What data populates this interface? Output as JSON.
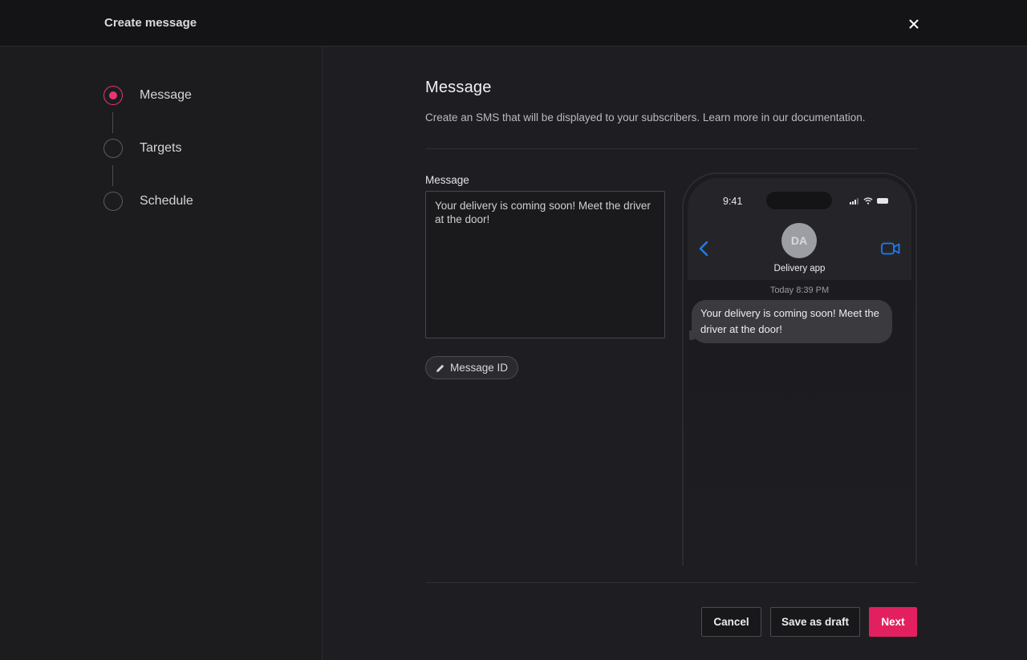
{
  "header": {
    "title": "Create message",
    "close_icon": "close-icon"
  },
  "steps": [
    {
      "label": "Message",
      "state": "active"
    },
    {
      "label": "Targets",
      "state": "pending"
    },
    {
      "label": "Schedule",
      "state": "pending"
    }
  ],
  "main": {
    "heading": "Message",
    "description": "Create an SMS that will be displayed to your subscribers. Learn more in our documentation.",
    "field_label": "Message",
    "message_value": "Your delivery is coming soon! Meet the driver at the door!",
    "chip_label": "Message ID"
  },
  "phone": {
    "time": "9:41",
    "avatar_initials": "DA",
    "contact_name": "Delivery app",
    "timestamp": "Today 8:39 PM",
    "bubble_text": "Your delivery is coming soon! Meet the driver at the door!"
  },
  "footer": {
    "cancel_label": "Cancel",
    "draft_label": "Save as draft",
    "next_label": "Next"
  },
  "colors": {
    "accent": "#e3205f",
    "ios_blue": "#1f7cf0"
  }
}
